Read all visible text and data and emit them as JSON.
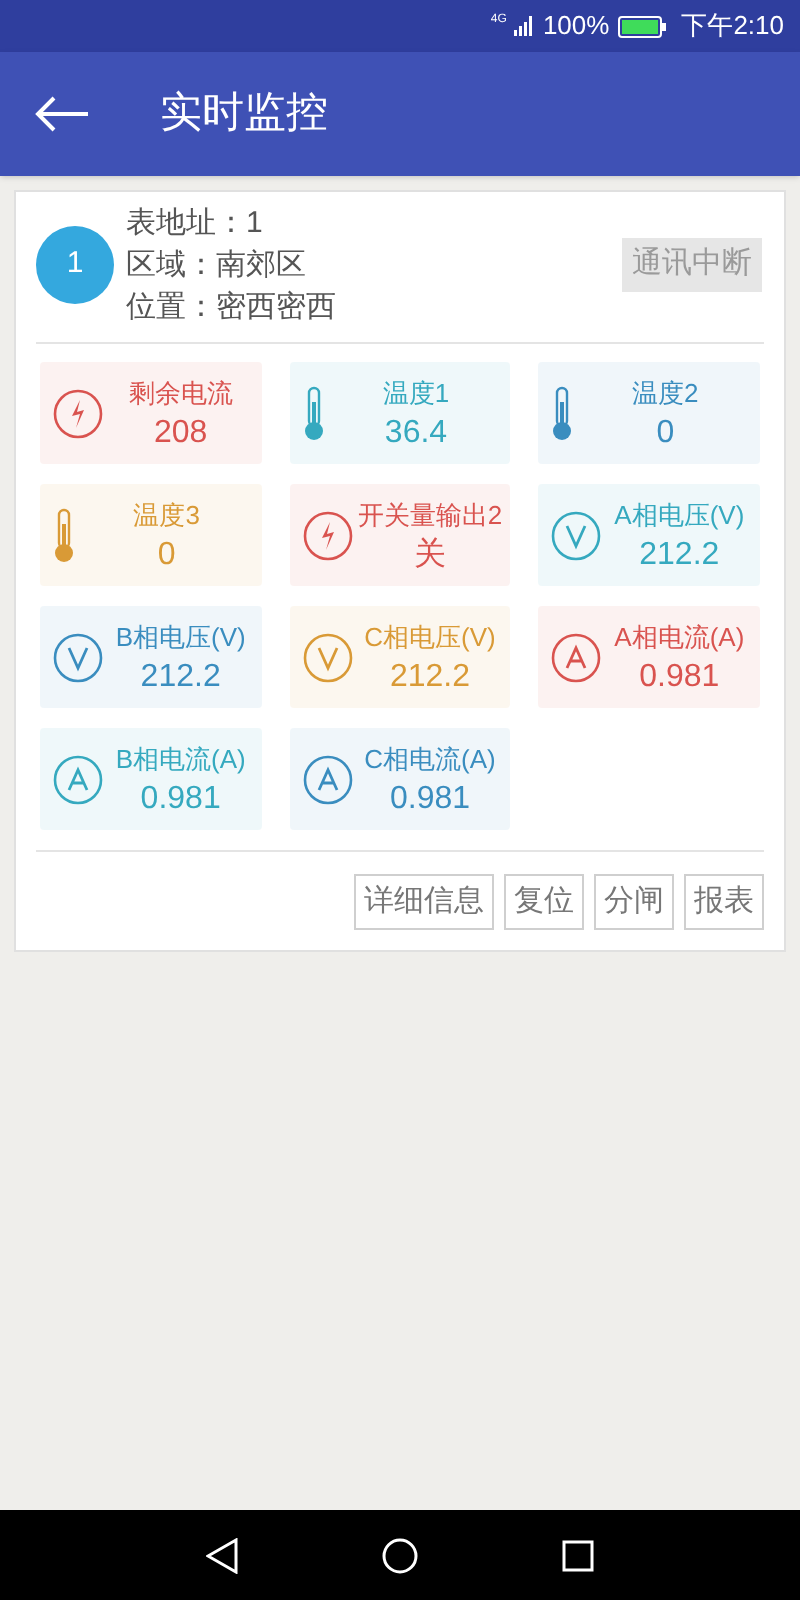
{
  "status_bar": {
    "network": "4G",
    "battery": "100%",
    "time": "下午2:10"
  },
  "header": {
    "title": "实时监控"
  },
  "meter": {
    "badge": "1",
    "address": "表地址：1",
    "area": "区域：南郊区",
    "location": "位置：密西密西",
    "status": "通讯中断"
  },
  "tiles": [
    {
      "label": "剩余电流",
      "value": "208",
      "kind": "bolt",
      "color": "#d9534f"
    },
    {
      "label": "温度1",
      "value": "36.4",
      "kind": "thermo",
      "color": "#35a9bf"
    },
    {
      "label": "温度2",
      "value": "0",
      "kind": "thermo",
      "color": "#3a8dbf"
    },
    {
      "label": "温度3",
      "value": "0",
      "kind": "thermo",
      "color": "#d99a36"
    },
    {
      "label": "开关量输出2",
      "value": "关",
      "kind": "bolt",
      "color": "#d9534f"
    },
    {
      "label": "A相电压(V)",
      "value": "212.2",
      "kind": "volt",
      "color": "#35a9bf"
    },
    {
      "label": "B相电压(V)",
      "value": "212.2",
      "kind": "volt",
      "color": "#3a8dbf"
    },
    {
      "label": "C相电压(V)",
      "value": "212.2",
      "kind": "volt",
      "color": "#d99a36"
    },
    {
      "label": "A相电流(A)",
      "value": "0.981",
      "kind": "amp",
      "color": "#d9534f"
    },
    {
      "label": "B相电流(A)",
      "value": "0.981",
      "kind": "amp",
      "color": "#35a9bf"
    },
    {
      "label": "C相电流(A)",
      "value": "0.981",
      "kind": "amp",
      "color": "#3a8dbf"
    }
  ],
  "actions": [
    "详细信息",
    "复位",
    "分闸",
    "报表"
  ]
}
